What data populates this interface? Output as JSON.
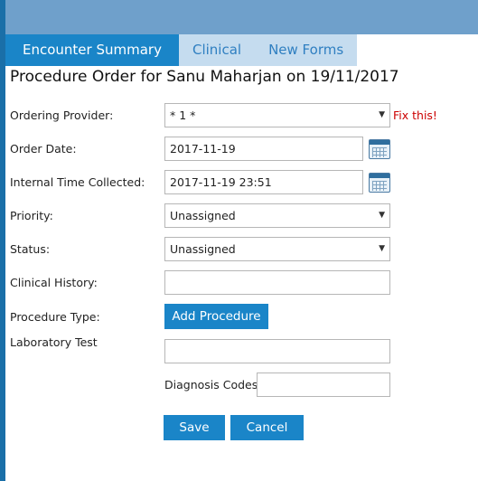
{
  "tabs": [
    {
      "label": "Encounter Summary",
      "active": true
    },
    {
      "label": "Clinical",
      "active": false
    },
    {
      "label": "New Forms",
      "active": false
    }
  ],
  "page_title": "Procedure Order for Sanu Maharjan on 19/11/2017",
  "form": {
    "ordering_provider": {
      "label": "Ordering Provider:",
      "value": "* 1 *",
      "error": "Fix this!"
    },
    "order_date": {
      "label": "Order Date:",
      "value": "2017-11-19"
    },
    "internal_time_collected": {
      "label": "Internal Time Collected:",
      "value": "2017-11-19 23:51"
    },
    "priority": {
      "label": "Priority:",
      "value": "Unassigned"
    },
    "status": {
      "label": "Status:",
      "value": "Unassigned"
    },
    "clinical_history": {
      "label": "Clinical History:",
      "value": ""
    },
    "procedure_type": {
      "label": "Procedure Type:",
      "button": "Add Procedure"
    },
    "laboratory_test": {
      "label": "Laboratory Test",
      "value": ""
    },
    "diagnosis_codes": {
      "label": "Diagnosis Codes:",
      "value": ""
    }
  },
  "actions": {
    "save": "Save",
    "cancel": "Cancel"
  },
  "icons": {
    "dropdown": "▼",
    "calendar": "calendar-icon"
  },
  "colors": {
    "accent": "#1a85c8",
    "tab_inactive": "#c5dcef",
    "header": "#6fa0cb",
    "error": "#cc0000"
  }
}
